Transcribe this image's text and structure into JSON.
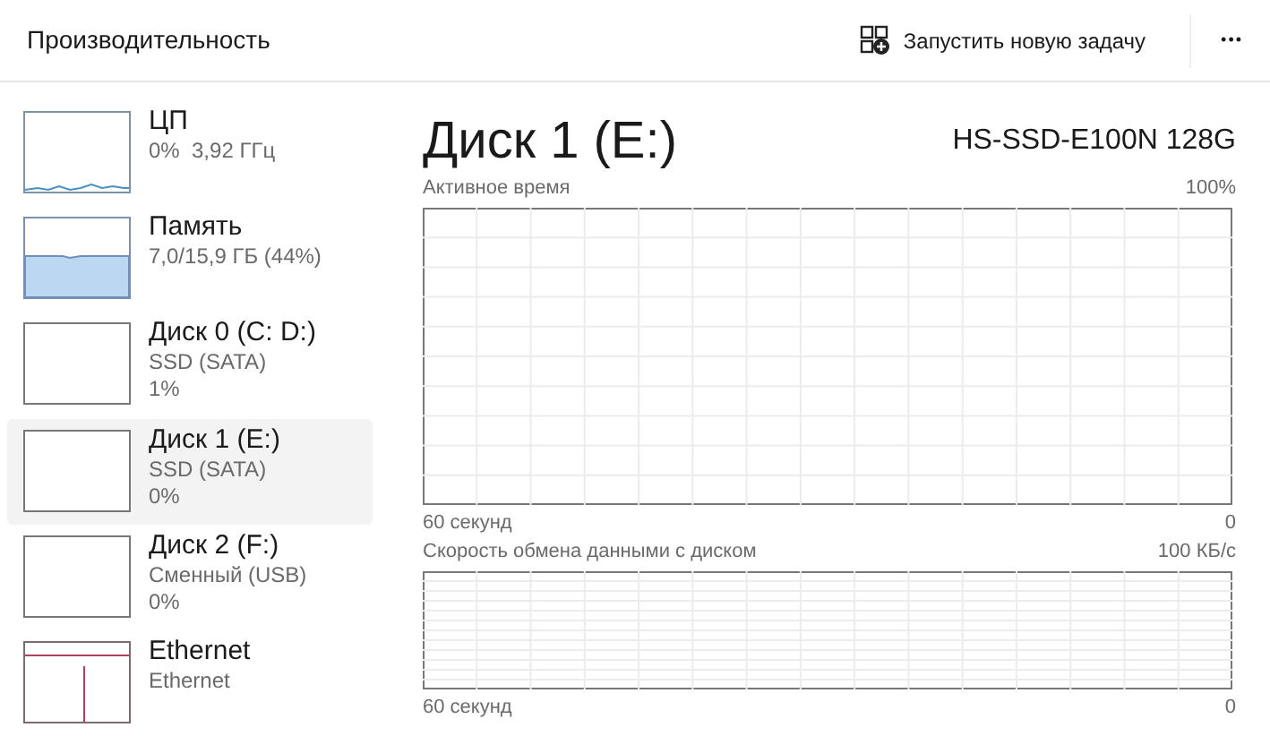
{
  "header": {
    "title": "Производительность",
    "new_task": "Запустить новую задачу",
    "more": "•••"
  },
  "sidebar": {
    "items": [
      {
        "kind": "cpu",
        "title": "ЦП",
        "lines": [
          "0%  3,92 ГГц"
        ],
        "selected": false
      },
      {
        "kind": "memory",
        "title": "Память",
        "lines": [
          "7,0/15,9 ГБ (44%)"
        ],
        "selected": false
      },
      {
        "kind": "disk",
        "title": "Диск 0 (C: D:)",
        "lines": [
          "SSD (SATA)",
          "1%"
        ],
        "selected": false
      },
      {
        "kind": "disk",
        "title": "Диск 1 (E:)",
        "lines": [
          "SSD (SATA)",
          "0%"
        ],
        "selected": true
      },
      {
        "kind": "disk",
        "title": "Диск 2 (F:)",
        "lines": [
          "Сменный (USB)",
          "0%"
        ],
        "selected": false
      },
      {
        "kind": "ethernet",
        "title": "Ethernet",
        "lines": [
          "Ethernet"
        ],
        "selected": false
      }
    ]
  },
  "main": {
    "title": "Диск 1 (E:)",
    "model": "HS-SSD-E100N 128G",
    "graphs": [
      {
        "label": "Активное время",
        "max": "100%",
        "time": "60 секунд",
        "min": "0",
        "kind": "tall"
      },
      {
        "label": "Скорость обмена данными с диском",
        "max": "100 КБ/с",
        "time": "60 секунд",
        "min": "0",
        "kind": "short"
      }
    ]
  }
}
